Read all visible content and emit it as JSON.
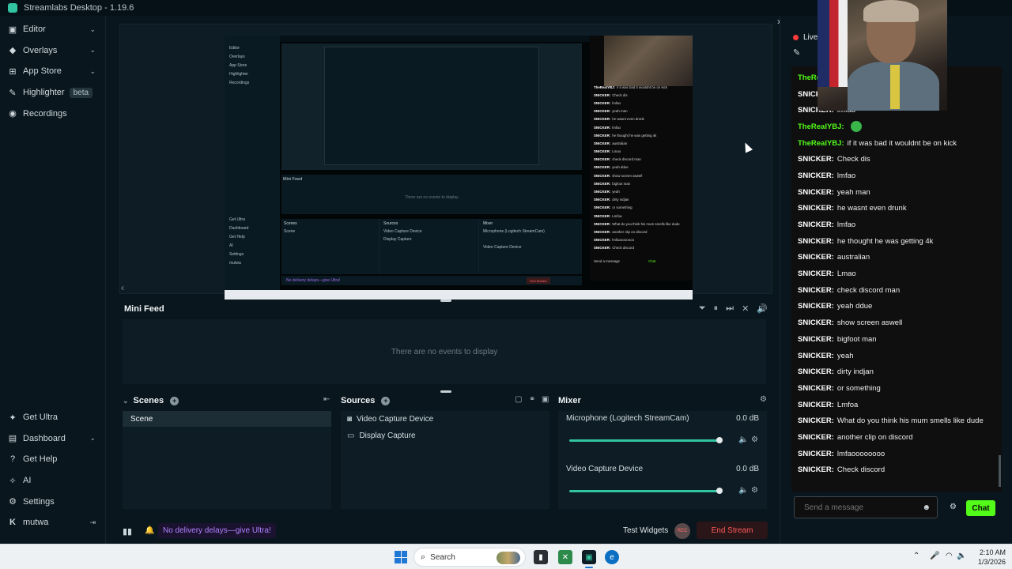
{
  "app": {
    "title": "Streamlabs Desktop - 1.19.6"
  },
  "nav": {
    "top": [
      {
        "label": "Editor",
        "icon": "editor-icon",
        "chevron": true
      },
      {
        "label": "Overlays",
        "icon": "overlays-icon",
        "chevron": true
      },
      {
        "label": "App Store",
        "icon": "appstore-icon",
        "chevron": true
      },
      {
        "label": "Highlighter",
        "icon": "highlighter-icon",
        "badge": "beta"
      },
      {
        "label": "Recordings",
        "icon": "recordings-icon"
      }
    ],
    "bottom": [
      {
        "label": "Get Ultra",
        "icon": "ultra-icon"
      },
      {
        "label": "Dashboard",
        "icon": "dashboard-icon",
        "chevron": true
      },
      {
        "label": "Get Help",
        "icon": "help-icon"
      },
      {
        "label": "AI",
        "icon": "ai-icon"
      },
      {
        "label": "Settings",
        "icon": "gear-icon"
      },
      {
        "label": "mutwa",
        "icon": "kick-icon"
      }
    ]
  },
  "minifeed": {
    "title": "Mini Feed",
    "empty": "There are no events to display"
  },
  "scenes": {
    "title": "Scenes",
    "items": [
      "Scene"
    ]
  },
  "sources": {
    "title": "Sources",
    "items": [
      {
        "label": "Video Capture Device",
        "icon": "camera-icon"
      },
      {
        "label": "Display Capture",
        "icon": "monitor-icon"
      }
    ]
  },
  "mixer": {
    "title": "Mixer",
    "items": [
      {
        "label": "Microphone (Logitech StreamCam)",
        "db": "0.0 dB",
        "level": 1.0
      },
      {
        "label": "Video Capture Device",
        "db": "0.0 dB",
        "level": 1.0
      }
    ]
  },
  "footer": {
    "ultra_pill": "No delivery delays—give Ultra!",
    "test_widgets": "Test Widgets",
    "rec_label": "REC",
    "end_stream": "End Stream"
  },
  "chat": {
    "live_label": "Live",
    "messages": [
      {
        "user": "TheRealYBJ:",
        "text": "",
        "green": true
      },
      {
        "user": "SNICKER:",
        "text": ""
      },
      {
        "user": "SNICKER:",
        "text": "lmfao"
      },
      {
        "user": "TheRealYBJ:",
        "text": "",
        "green": true,
        "emote": true
      },
      {
        "user": "TheRealYBJ:",
        "text": "if it was bad it wouldnt be on kick",
        "green": true
      },
      {
        "user": "SNICKER:",
        "text": "Check dis"
      },
      {
        "user": "SNICKER:",
        "text": "lmfao"
      },
      {
        "user": "SNICKER:",
        "text": "yeah man"
      },
      {
        "user": "SNICKER:",
        "text": "he wasnt even drunk"
      },
      {
        "user": "SNICKER:",
        "text": "lmfao"
      },
      {
        "user": "SNICKER:",
        "text": "he thought he was getting 4k"
      },
      {
        "user": "SNICKER:",
        "text": "australian"
      },
      {
        "user": "SNICKER:",
        "text": "Lmao"
      },
      {
        "user": "SNICKER:",
        "text": "check discord man"
      },
      {
        "user": "SNICKER:",
        "text": "yeah ddue"
      },
      {
        "user": "SNICKER:",
        "text": "show screen aswell"
      },
      {
        "user": "SNICKER:",
        "text": "bigfoot man"
      },
      {
        "user": "SNICKER:",
        "text": "yeah"
      },
      {
        "user": "SNICKER:",
        "text": "dirty indjan"
      },
      {
        "user": "SNICKER:",
        "text": "or something"
      },
      {
        "user": "SNICKER:",
        "text": "Lmfoa"
      },
      {
        "user": "SNICKER:",
        "text": "What do you think his mum smells like dude"
      },
      {
        "user": "SNICKER:",
        "text": "another clip on discord"
      },
      {
        "user": "SNICKER:",
        "text": "lmfaoooooooo"
      },
      {
        "user": "SNICKER:",
        "text": "Check discord"
      }
    ],
    "input_placeholder": "Send a message",
    "send_label": "Chat"
  },
  "taskbar": {
    "search_placeholder": "Search",
    "time": "2:10 AM",
    "date": "1/3/2026"
  },
  "preview": {
    "mini_feed": "Mini Feed",
    "empty": "There are no events to display",
    "scenes": "Scenes",
    "scene": "Scene",
    "sources": "Sources",
    "mixer": "Mixer",
    "src1": "Video Capture Device",
    "src2": "Display Capture",
    "mic": "Microphone (Logitech StreamCam)",
    "vcd": "Video Capture Device",
    "ultra": "No delivery delays—give Ultra!",
    "end": "End Stream",
    "send": "Send a message",
    "chat": "Chat"
  },
  "colors": {
    "accent": "#31c3a2",
    "kick_green": "#53fc18",
    "end_stream": "#ff5a5a",
    "ultra": "#b182ff"
  }
}
